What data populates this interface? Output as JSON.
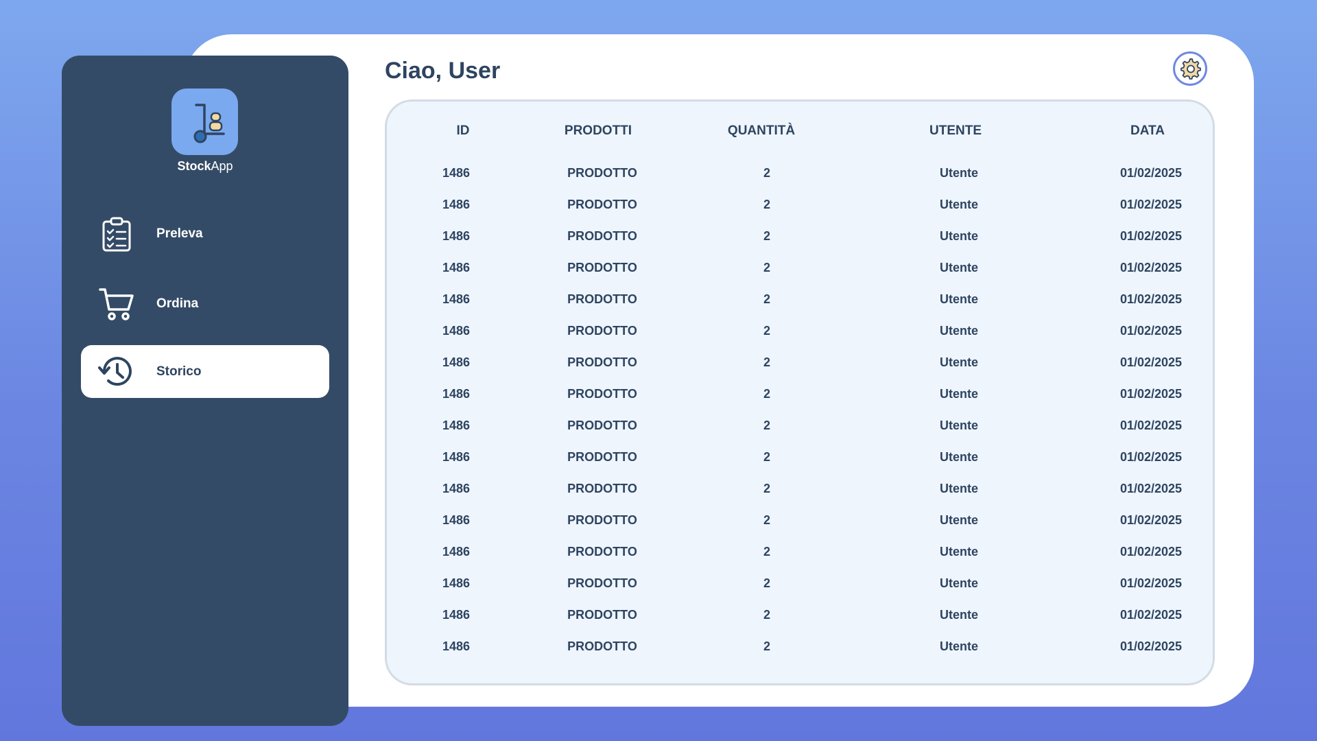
{
  "app": {
    "name_bold": "Stock",
    "name_light": "App"
  },
  "greeting": "Ciao, User",
  "nav": [
    {
      "label": "Preleva",
      "icon": "clipboard-checklist-icon",
      "active": false
    },
    {
      "label": "Ordina",
      "icon": "shopping-cart-icon",
      "active": false
    },
    {
      "label": "Storico",
      "icon": "history-icon",
      "active": true
    }
  ],
  "settings": {
    "icon": "gear-icon"
  },
  "table": {
    "columns": [
      "ID",
      "PRODOTTI",
      "QUANTITÀ",
      "UTENTE",
      "DATA"
    ],
    "rows": [
      [
        "1486",
        "PRODOTTO",
        "2",
        "Utente",
        "01/02/2025"
      ],
      [
        "1486",
        "PRODOTTO",
        "2",
        "Utente",
        "01/02/2025"
      ],
      [
        "1486",
        "PRODOTTO",
        "2",
        "Utente",
        "01/02/2025"
      ],
      [
        "1486",
        "PRODOTTO",
        "2",
        "Utente",
        "01/02/2025"
      ],
      [
        "1486",
        "PRODOTTO",
        "2",
        "Utente",
        "01/02/2025"
      ],
      [
        "1486",
        "PRODOTTO",
        "2",
        "Utente",
        "01/02/2025"
      ],
      [
        "1486",
        "PRODOTTO",
        "2",
        "Utente",
        "01/02/2025"
      ],
      [
        "1486",
        "PRODOTTO",
        "2",
        "Utente",
        "01/02/2025"
      ],
      [
        "1486",
        "PRODOTTO",
        "2",
        "Utente",
        "01/02/2025"
      ],
      [
        "1486",
        "PRODOTTO",
        "2",
        "Utente",
        "01/02/2025"
      ],
      [
        "1486",
        "PRODOTTO",
        "2",
        "Utente",
        "01/02/2025"
      ],
      [
        "1486",
        "PRODOTTO",
        "2",
        "Utente",
        "01/02/2025"
      ],
      [
        "1486",
        "PRODOTTO",
        "2",
        "Utente",
        "01/02/2025"
      ],
      [
        "1486",
        "PRODOTTO",
        "2",
        "Utente",
        "01/02/2025"
      ],
      [
        "1486",
        "PRODOTTO",
        "2",
        "Utente",
        "01/02/2025"
      ],
      [
        "1486",
        "PRODOTTO",
        "2",
        "Utente",
        "01/02/2025"
      ]
    ]
  },
  "colors": {
    "sidebar": "#344b67",
    "text_dark": "#2e4460",
    "accent": "#7aa9ef",
    "table_bg": "#eef5fd"
  }
}
